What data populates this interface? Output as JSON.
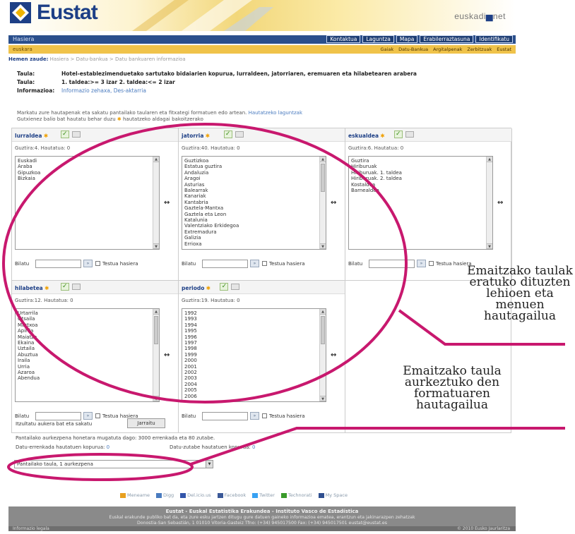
{
  "header": {
    "logo": "Eustat",
    "euskadi_prefix": "euskadi",
    "euskadi_suffix": "net"
  },
  "nav": {
    "home": "Hasiera",
    "links": [
      "Kontaktua",
      "Laguntza",
      "Mapa",
      "Erabilerraztasuna",
      "Identifikatu"
    ]
  },
  "subnav": {
    "left": "euskara",
    "links": [
      "Gaiak",
      "Datu-Bankua",
      "Argitalpenak",
      "Zerbitzuak",
      "Eustat"
    ]
  },
  "breadcrumb": {
    "label": "Hemen zaude:",
    "path": "Hasiera > Datu-bankua > Datu bankuaren informazioa"
  },
  "info": {
    "taula_label": "Taula:",
    "taula_value": "Hotel-establezimenduetako sartutako bidaiarien kopurua, lurraldeen, jatorriaren, eremuaren eta hilabetearen arabera",
    "taula2_label": "Taula:",
    "taula2_value": "1. taldea:>= 3 izar 2. taldea:<= 2 izar",
    "informazioa_label": "Informazioa:",
    "informazioa_value": "Informazio zehaxa, Des-aktarria"
  },
  "instructions": {
    "line1": "Markatu zure hautapenak eta sakatu pantailako taularen eta fitxategi formatuen edo artean.",
    "line1_link": "Hautatzeko laguntzak",
    "line2a": "Gutxienez balio bat hautatu behar duzu",
    "line2b": "hautatzeko aldagai bakoitzerako"
  },
  "selectors": [
    {
      "title": "lurraldea",
      "count": "Guztira:4. Hautatua: 0",
      "items": [
        "Euskadi",
        "Araba",
        "Gipuzkoa",
        "Bizkaia"
      ]
    },
    {
      "title": "jatorria",
      "count": "Guztira:40. Hautatua: 0",
      "items": [
        "Guztizkoa",
        "Estatua guztira",
        "Andaluzia",
        "Aragoi",
        "Asturias",
        "Balearrak",
        "Kanariak",
        "Kantabria",
        "Gaztela-Mantxa",
        "Gaztela eta Leon",
        "Katalunia",
        "Valentziako Erkidegoa",
        "Extremadura",
        "Galizia",
        "Errioxa"
      ]
    },
    {
      "title": "eskualdea",
      "count": "Guztira:6. Hautatua: 0",
      "items": [
        "Guztira",
        "Hiriburuak",
        "Hiriburuak. 1. taldea",
        "Hiriburuak. 2. taldea",
        "Kostaldea",
        "Barnealdea"
      ]
    },
    {
      "title": "hilabetea",
      "count": "Guztira:12. Hautatua: 0",
      "items": [
        "Urtarrila",
        "Otsaila",
        "Martxoa",
        "Apirila",
        "Maiatza",
        "Ekaina",
        "Uztaila",
        "Abuztua",
        "Iraila",
        "Urria",
        "Azaroa",
        "Abendua"
      ]
    },
    {
      "title": "periodo",
      "count": "Guztira:19. Hautatua: 0",
      "items": [
        "1992",
        "1993",
        "1994",
        "1995",
        "1996",
        "1997",
        "1998",
        "1999",
        "2000",
        "2001",
        "2002",
        "2003",
        "2004",
        "2005",
        "2006"
      ]
    }
  ],
  "search": {
    "label": "Bilatu",
    "checkbox_label": "Testua hasiera"
  },
  "pivot": {
    "label": "Itzultatu aukera bat eta sakatu",
    "button": "Jarraitu"
  },
  "page_info": {
    "line1": "Pantailako aurkezpena honetara mugatuta dago: 3000 errenkada eta 80 zutabe.",
    "rows_label": "Datu-errenkada hautatuen kopurua:",
    "rows_value": "0",
    "cols_label": "Datu-zutabe hautatuen kopurua:",
    "cols_value": "0"
  },
  "format_select": {
    "value": "Pantailako taula, 1 aurkezpena"
  },
  "social": [
    "Meneame",
    "Digg",
    "Del.icio.us",
    "Facebook",
    "Twitter",
    "Technorati",
    "My Space"
  ],
  "footer": {
    "title": "Eustat - Euskal Estatistika Erakundea - Instituto Vasco de Estadística",
    "line2": "Euskal erakunde publiko bat da, eta zure esku jartzen ditugu gure datuen gaineko informazioa ematea, erantzun eta jakinarazpen zehatzak",
    "line3": "Donostia-San Sebastián, 1 01010 Vitoria-Gasteiz  Tfno: (+34) 945017500  Fax: (+34) 945017501  eustat@eustat.es",
    "bottom_left": "Informazio legala",
    "bottom_right": "© 2010 Eusko Jaurlaritza"
  },
  "annotations": {
    "top": "Emaitzako taulak eratuko dituzten lehioen eta menuen hautagailua",
    "bottom": "Emaitzako taula aurkeztuko den formatuaren hautagailua"
  },
  "colors": {
    "nav_blue": "#2b4f8c",
    "accent_yellow": "#f0c34a",
    "annotation_magenta": "#c8186e",
    "footer_grey": "#8a8a8a"
  }
}
